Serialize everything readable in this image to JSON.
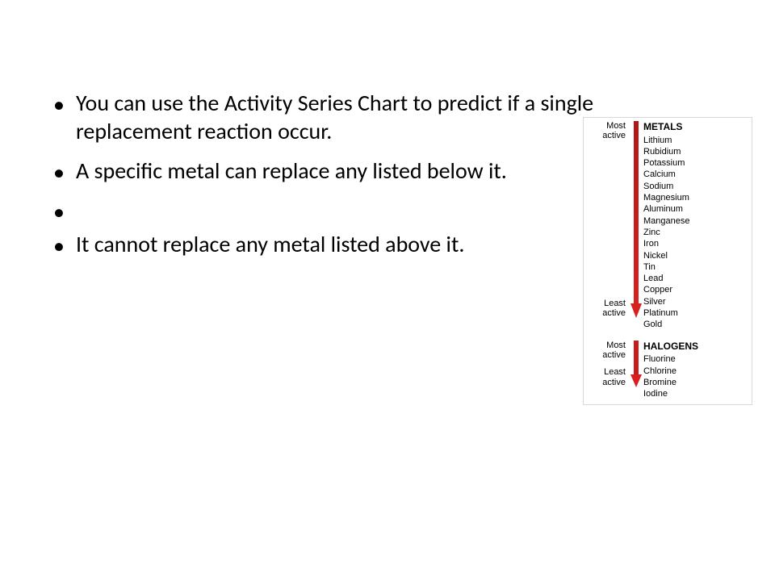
{
  "bullets": {
    "b1": "You can use the Activity Series Chart to predict if a single replacement reaction occur.",
    "b2": "A specific metal can replace any listed below it.",
    "b3": "It cannot replace any metal listed above it."
  },
  "chart": {
    "labels": {
      "most_active": "Most active",
      "least_active": "Least active",
      "most_active2": "Most active",
      "least_active2": "Least active"
    },
    "metals_heading": "METALS",
    "halogens_heading": "HALOGENS",
    "metals": [
      "Lithium",
      "Rubidium",
      "Potassium",
      "Calcium",
      "Sodium",
      "Magnesium",
      "Aluminum",
      "Manganese",
      "Zinc",
      "Iron",
      "Nickel",
      "Tin",
      "Lead",
      "Copper",
      "Silver",
      "Platinum",
      "Gold"
    ],
    "halogens": [
      "Fluorine",
      "Chlorine",
      "Bromine",
      "Iodine"
    ]
  },
  "chart_data": {
    "type": "table",
    "title": "Activity Series",
    "series": [
      {
        "name": "METALS",
        "ordering": "most_active_to_least_active",
        "values": [
          "Lithium",
          "Rubidium",
          "Potassium",
          "Calcium",
          "Sodium",
          "Magnesium",
          "Aluminum",
          "Manganese",
          "Zinc",
          "Iron",
          "Nickel",
          "Tin",
          "Lead",
          "Copper",
          "Silver",
          "Platinum",
          "Gold"
        ]
      },
      {
        "name": "HALOGENS",
        "ordering": "most_active_to_least_active",
        "values": [
          "Fluorine",
          "Chlorine",
          "Bromine",
          "Iodine"
        ]
      }
    ]
  }
}
